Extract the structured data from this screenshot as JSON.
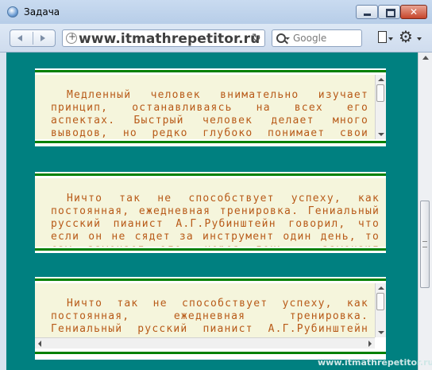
{
  "window": {
    "title": "Задача"
  },
  "toolbar": {
    "url": "www.itmathrepetitor.ru",
    "search_placeholder": "Google"
  },
  "boxes": [
    {
      "text": "Медленный человек внимательно изучает принцип, останавливаясь на всех его аспектах. Быстрый человек делает много выводов, но редко глубоко понимает свои ошибки. Тот, кто бежит за всем, ничего не видит."
    },
    {
      "text": "Ничто так не способствует успеху, как постоянная, ежедневная тренировка. Гениальный русский пианист А.Г.Рубинштейн говорил, что если он не сядет за инструмент один день, то сам замечает это, через день — замечают друзья."
    },
    {
      "text": "Ничто так не способствует успеху, как постоянная, ежедневная тренировка. Гениальный русский пианист А.Г.Рубинштейн говорил, что если он не сядет за инструмент один день, то сам замечает это."
    }
  ],
  "watermark": "www.itmathrepetitor.ru"
}
